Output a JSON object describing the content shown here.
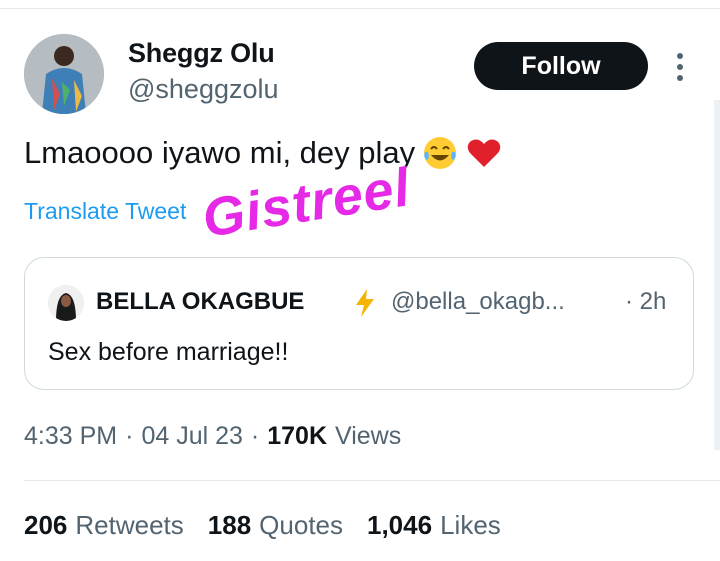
{
  "author": {
    "name": "Sheggz Olu",
    "handle": "@sheggzolu"
  },
  "follow_label": "Follow",
  "tweet": {
    "text": "Lmaoooo iyawo mi, dey play",
    "emojis": [
      "face-with-tears-of-joy",
      "red-heart"
    ],
    "translate_label": "Translate Tweet"
  },
  "watermark": "Gistreel",
  "quoted": {
    "name": "BELLA OKAGBUE",
    "badge_icon": "lightning-bolt",
    "handle": "@bella_okagb...",
    "time": "· 2h",
    "text": "Sex before marriage!!"
  },
  "meta": {
    "time": "4:33 PM",
    "sep1": "·",
    "date": "04 Jul 23",
    "sep2": "·",
    "views_count": "170K",
    "views_label": "Views"
  },
  "stats": [
    {
      "count": "206",
      "label": "Retweets"
    },
    {
      "count": "188",
      "label": "Quotes"
    },
    {
      "count": "1,046",
      "label": "Likes"
    }
  ],
  "colors": {
    "accent": "#1d9bf0",
    "text": "#0f1419",
    "muted": "#536471",
    "watermark": "#e629e6",
    "follow_bg": "#0f1419"
  }
}
